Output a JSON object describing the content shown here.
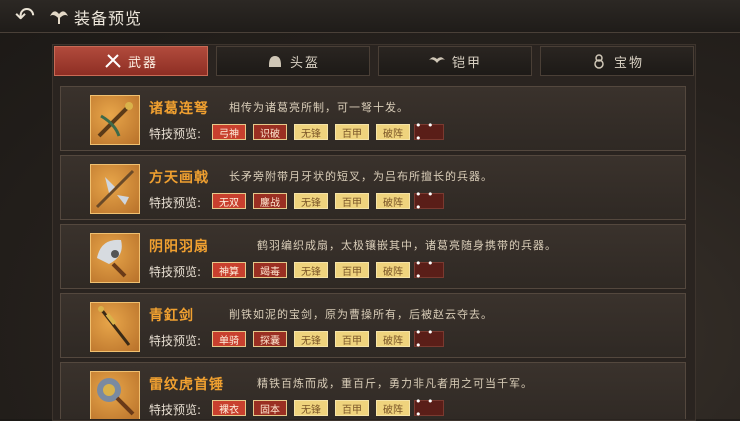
{
  "header": {
    "title": "装备预览",
    "back_icon": "back-arrow-icon"
  },
  "tabs": [
    {
      "label": "武器",
      "icon": "crossed-swords-icon",
      "active": true
    },
    {
      "label": "头盔",
      "icon": "helmet-icon",
      "active": false
    },
    {
      "label": "铠甲",
      "icon": "armor-icon",
      "active": false
    },
    {
      "label": "宝物",
      "icon": "gourd-icon",
      "active": false
    }
  ],
  "skill_label": "特技预览:",
  "more_label": "• • •",
  "items": [
    {
      "name": "诸葛连弩",
      "desc": "相传为诸葛亮所制，可一弩十发。",
      "icon": "crossbow-icon",
      "skills": [
        "弓神",
        "识破",
        "无锋",
        "百甲",
        "破阵"
      ]
    },
    {
      "name": "方天画戟",
      "desc": "长矛旁附带月牙状的短叉，为吕布所擅长的兵器。",
      "icon": "halberd-icon",
      "skills": [
        "无双",
        "鏖战",
        "无锋",
        "百甲",
        "破阵"
      ]
    },
    {
      "name": "阴阳羽扇",
      "desc": "鹤羽编织成扇，太极镶嵌其中，诸葛亮随身携带的兵器。",
      "icon": "feather-fan-icon",
      "skills": [
        "神算",
        "竭毒",
        "无锋",
        "百甲",
        "破阵"
      ]
    },
    {
      "name": "青釭剑",
      "desc": "削铁如泥的宝剑，原为曹操所有，后被赵云夺去。",
      "icon": "sword-icon",
      "skills": [
        "单骑",
        "探囊",
        "无锋",
        "百甲",
        "破阵"
      ]
    },
    {
      "name": "雷纹虎首锤",
      "desc": "精铁百炼而成，重百斤，勇力非凡者用之可当千军。",
      "icon": "hammer-icon",
      "skills": [
        "裸衣",
        "固本",
        "无锋",
        "百甲",
        "破阵"
      ]
    }
  ],
  "colors": {
    "accent_tab": "#a33d30",
    "item_name": "#f0a030",
    "badge_red": "#c8402e",
    "badge_yellow": "#efd37d"
  }
}
